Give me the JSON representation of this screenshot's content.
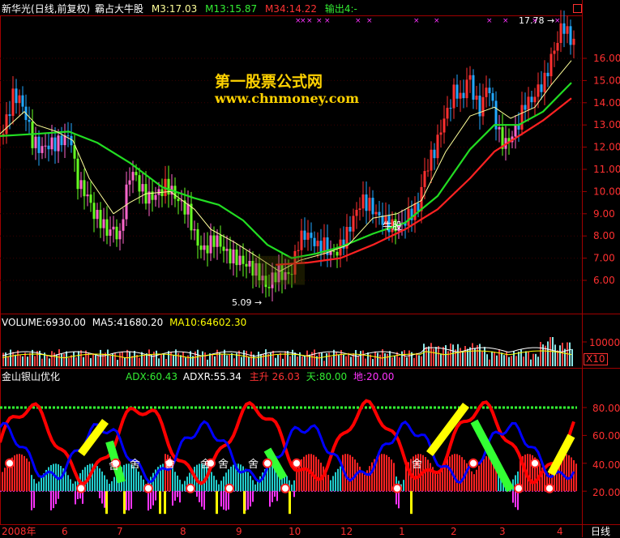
{
  "header": {
    "stock": "新华光",
    "mode": "(日线,前复权)",
    "formula": "霸占大牛股",
    "m3": "M3:17.03",
    "m13": "M13:15.87",
    "m34": "M34:14.22",
    "out4": "输出4:-"
  },
  "watermark": {
    "line1": "第一股票公式网",
    "line2": "www.chnmoney.com"
  },
  "colors": {
    "bg": "#000000",
    "frame": "#a00000",
    "axis_text": "#ff3030",
    "up": "#ff3030",
    "down_a": "#22a8ff",
    "down_b": "#66ff22",
    "pink": "#ff66cc",
    "m3": "#ffff99",
    "m13": "#22dd22",
    "m34": "#ff2222",
    "green_line": "#33ff33",
    "magenta_bar": "#ff33ff",
    "yellow_bar": "#ffff00",
    "cyan_bar": "#22cccc",
    "ma5": "#ffffff",
    "ma10": "#ffff00",
    "adx_line": "#0000ff",
    "adxr_line": "#ff0000"
  },
  "panel_volume": {
    "vol": "VOLUME:6930.00",
    "ma5": "MA5:41680.20",
    "ma10": "MA10:64602.30",
    "tick": "10000",
    "unit": "X10"
  },
  "panel_ind": {
    "name": "金山银山优化",
    "adx": "ADX:60.43",
    "adxr": "ADXR:55.34",
    "zhusheng": "主升 26.03",
    "tian": "天:80.00",
    "di": "地:20.00",
    "ticks": [
      "80.00",
      "60.00",
      "40.00",
      "20.00"
    ],
    "markers": [
      "舍",
      "舍",
      "舍",
      "舍",
      "舍",
      "舍",
      "舍"
    ]
  },
  "x_axis": {
    "labels": [
      "2008年",
      "6",
      "7",
      "8",
      "9",
      "10",
      "12",
      "1",
      "2",
      "3",
      "4"
    ],
    "period": "日线"
  },
  "chart_data": {
    "type": "candlestick",
    "y_ticks": [
      6.0,
      7.0,
      8.0,
      9.0,
      10.0,
      11.0,
      12.0,
      13.0,
      14.0,
      15.0,
      16.0
    ],
    "ylim": [
      5.0,
      17.5
    ],
    "annotations": [
      {
        "label": "5.09",
        "value": 5.09
      },
      {
        "label": "17.78",
        "value": 17.78
      },
      {
        "label": "牛股",
        "value": 8.3
      }
    ],
    "close_path": [
      [
        0,
        12.3
      ],
      [
        8,
        13.2
      ],
      [
        16,
        14.3
      ],
      [
        24,
        14.2
      ],
      [
        32,
        13.4
      ],
      [
        40,
        12.3
      ],
      [
        50,
        11.9
      ],
      [
        60,
        12.1
      ],
      [
        72,
        12.2
      ],
      [
        82,
        12.5
      ],
      [
        88,
        12.3
      ],
      [
        94,
        10.6
      ],
      [
        100,
        10.2
      ],
      [
        108,
        9.8
      ],
      [
        116,
        9.0
      ],
      [
        124,
        8.7
      ],
      [
        132,
        8.2
      ],
      [
        140,
        8.3
      ],
      [
        148,
        7.9
      ],
      [
        154,
        9.7
      ],
      [
        162,
        11.0
      ],
      [
        168,
        10.6
      ],
      [
        174,
        10.1
      ],
      [
        182,
        9.7
      ],
      [
        190,
        9.8
      ],
      [
        198,
        10.0
      ],
      [
        206,
        10.3
      ],
      [
        214,
        9.9
      ],
      [
        222,
        9.5
      ],
      [
        232,
        9.1
      ],
      [
        242,
        7.8
      ],
      [
        250,
        7.3
      ],
      [
        258,
        7.6
      ],
      [
        266,
        7.9
      ],
      [
        274,
        7.5
      ],
      [
        282,
        7.1
      ],
      [
        292,
        7.0
      ],
      [
        300,
        6.8
      ],
      [
        310,
        6.6
      ],
      [
        320,
        6.3
      ],
      [
        330,
        5.6
      ],
      [
        336,
        6.1
      ],
      [
        344,
        6.4
      ],
      [
        352,
        6.2
      ],
      [
        360,
        6.4
      ],
      [
        368,
        7.7
      ],
      [
        376,
        8.1
      ],
      [
        384,
        7.9
      ],
      [
        392,
        7.5
      ],
      [
        400,
        7.6
      ],
      [
        408,
        7.2
      ],
      [
        416,
        7.3
      ],
      [
        426,
        7.9
      ],
      [
        436,
        8.8
      ],
      [
        446,
        9.6
      ],
      [
        456,
        9.4
      ],
      [
        466,
        8.9
      ],
      [
        476,
        8.6
      ],
      [
        486,
        8.4
      ],
      [
        496,
        8.5
      ],
      [
        506,
        9.0
      ],
      [
        516,
        9.3
      ],
      [
        522,
        10.6
      ],
      [
        530,
        11.4
      ],
      [
        538,
        12.0
      ],
      [
        546,
        13.1
      ],
      [
        554,
        13.8
      ],
      [
        562,
        14.7
      ],
      [
        570,
        14.0
      ],
      [
        578,
        15.4
      ],
      [
        586,
        14.1
      ],
      [
        594,
        13.6
      ],
      [
        600,
        14.8
      ],
      [
        606,
        14.3
      ],
      [
        614,
        12.7
      ],
      [
        622,
        12.1
      ],
      [
        630,
        12.4
      ],
      [
        640,
        13.1
      ],
      [
        648,
        14.0
      ],
      [
        656,
        14.1
      ],
      [
        664,
        14.6
      ],
      [
        672,
        15.0
      ],
      [
        680,
        16.0
      ],
      [
        688,
        16.8
      ],
      [
        694,
        17.6
      ],
      [
        700,
        17.1
      ],
      [
        708,
        16.7
      ]
    ],
    "m3_path": [
      [
        0,
        12.6
      ],
      [
        30,
        13.6
      ],
      [
        45,
        13.0
      ],
      [
        70,
        12.7
      ],
      [
        90,
        12.3
      ],
      [
        110,
        10.6
      ],
      [
        140,
        9.0
      ],
      [
        160,
        9.5
      ],
      [
        180,
        9.9
      ],
      [
        210,
        10.0
      ],
      [
        240,
        9.2
      ],
      [
        260,
        8.3
      ],
      [
        290,
        7.7
      ],
      [
        320,
        7.0
      ],
      [
        345,
        6.4
      ],
      [
        370,
        6.9
      ],
      [
        400,
        7.2
      ],
      [
        430,
        7.6
      ],
      [
        460,
        8.8
      ],
      [
        490,
        9.0
      ],
      [
        520,
        9.6
      ],
      [
        550,
        11.8
      ],
      [
        580,
        13.4
      ],
      [
        610,
        13.8
      ],
      [
        630,
        13.3
      ],
      [
        660,
        13.8
      ],
      [
        680,
        14.8
      ],
      [
        705,
        15.9
      ]
    ],
    "m13_path": [
      [
        0,
        12.5
      ],
      [
        45,
        12.6
      ],
      [
        85,
        12.7
      ],
      [
        120,
        12.2
      ],
      [
        160,
        11.3
      ],
      [
        200,
        10.2
      ],
      [
        240,
        9.7
      ],
      [
        270,
        9.4
      ],
      [
        300,
        8.7
      ],
      [
        330,
        7.6
      ],
      [
        360,
        7.0
      ],
      [
        390,
        7.2
      ],
      [
        420,
        7.5
      ],
      [
        460,
        8.1
      ],
      [
        500,
        8.6
      ],
      [
        540,
        9.8
      ],
      [
        580,
        11.9
      ],
      [
        610,
        13.0
      ],
      [
        640,
        13.0
      ],
      [
        670,
        13.6
      ],
      [
        705,
        14.9
      ]
    ],
    "m34_path": [
      [
        340,
        6.7
      ],
      [
        380,
        6.8
      ],
      [
        420,
        7.0
      ],
      [
        460,
        7.6
      ],
      [
        500,
        8.3
      ],
      [
        540,
        9.2
      ],
      [
        580,
        10.6
      ],
      [
        610,
        11.8
      ],
      [
        640,
        12.5
      ],
      [
        670,
        13.2
      ],
      [
        705,
        14.2
      ]
    ]
  }
}
